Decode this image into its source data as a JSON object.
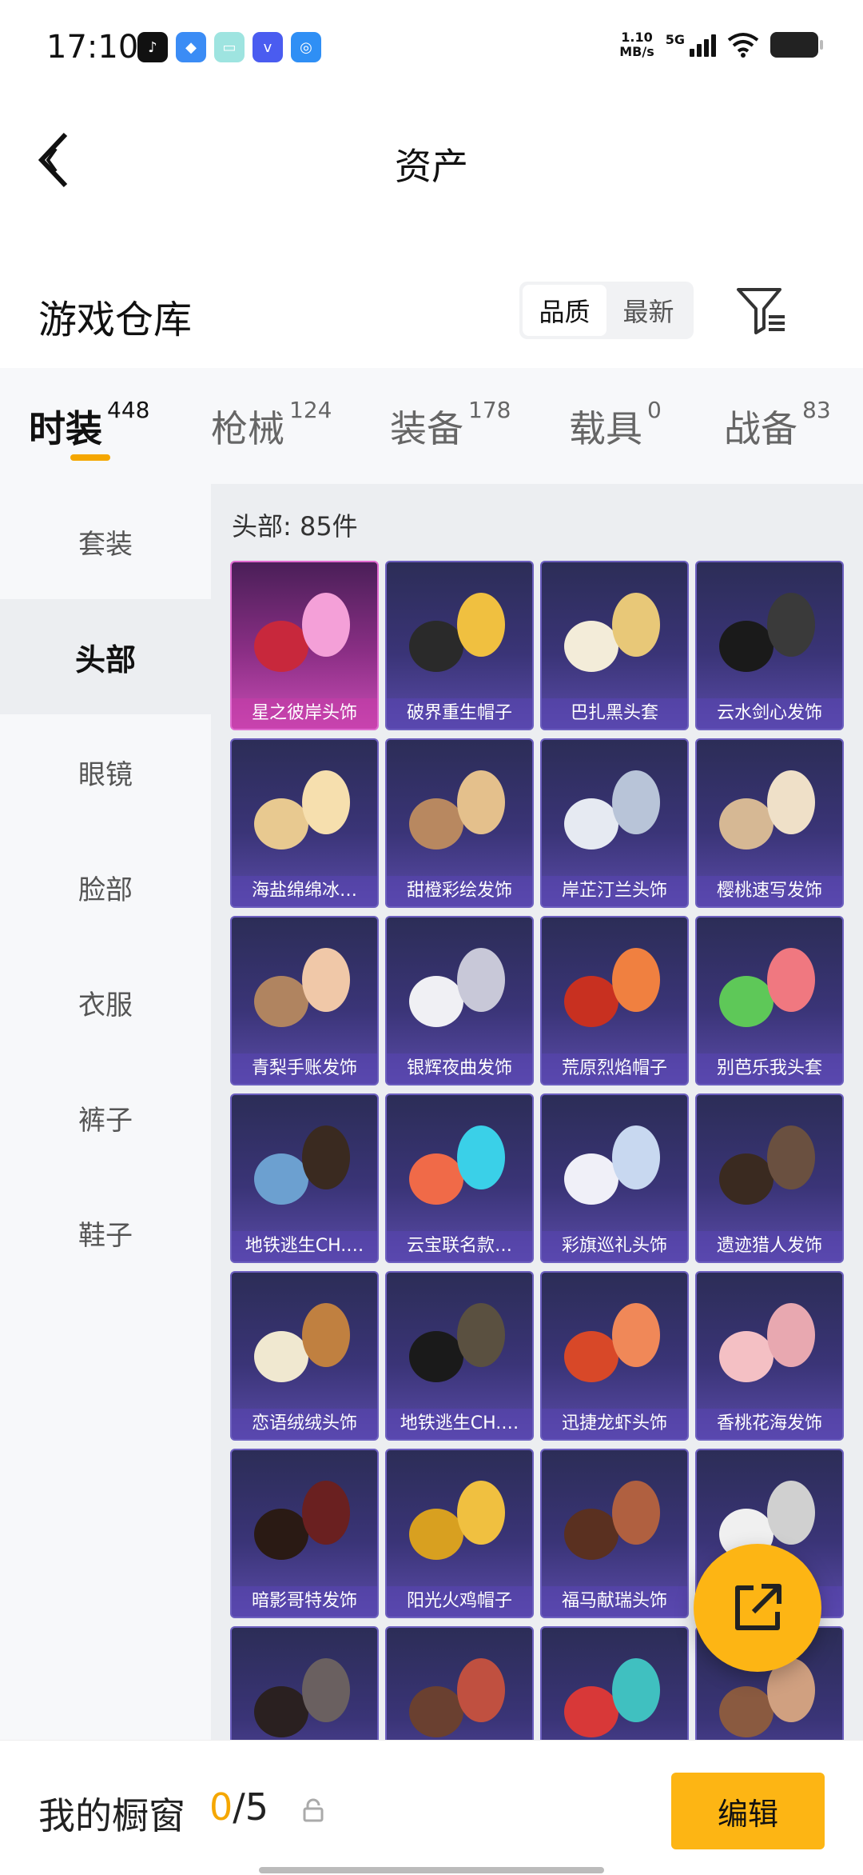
{
  "status_bar": {
    "time": "17:10",
    "net_speed_value": "1.10",
    "net_speed_unit": "MB/s",
    "network": "5G"
  },
  "header": {
    "title": "资产"
  },
  "warehouse": {
    "title": "游戏仓库",
    "sort_options": [
      "品质",
      "最新"
    ],
    "sort_selected": "品质"
  },
  "tabs": [
    {
      "label": "时装",
      "count": "448"
    },
    {
      "label": "枪械",
      "count": "124"
    },
    {
      "label": "装备",
      "count": "178"
    },
    {
      "label": "载具",
      "count": "0"
    },
    {
      "label": "战备",
      "count": "83"
    }
  ],
  "sidebar": {
    "items": [
      "套装",
      "头部",
      "眼镜",
      "脸部",
      "衣服",
      "裤子",
      "鞋子"
    ],
    "active": "头部"
  },
  "category_count": "头部: 85件",
  "items": [
    "星之彼岸头饰",
    "破界重生帽子",
    "巴扎黑头套",
    "云水剑心发饰",
    "海盐绵绵冰…",
    "甜橙彩绘发饰",
    "岸芷汀兰头饰",
    "樱桃速写发饰",
    "青梨手账发饰",
    "银辉夜曲发饰",
    "荒原烈焰帽子",
    "别芭乐我头套",
    "地铁逃生CH.…",
    "云宝联名款…",
    "彩旗巡礼头饰",
    "遗迹猎人发饰",
    "恋语绒绒头饰",
    "地铁逃生CH.…",
    "迅捷龙虾头饰",
    "香桃花海发饰",
    "暗影哥特发饰",
    "阳光火鸡帽子",
    "福马献瑞头饰",
    "",
    "",
    "",
    "",
    ""
  ],
  "bottom": {
    "window_label": "我的橱窗",
    "current": "0",
    "separator": "/",
    "max": "5",
    "edit_label": "编辑"
  },
  "colors": {
    "accent": "#fdb514",
    "tab_indicator": "#f5a700",
    "card_purple": "#3a3477",
    "card_pink": "#c84cb4"
  }
}
